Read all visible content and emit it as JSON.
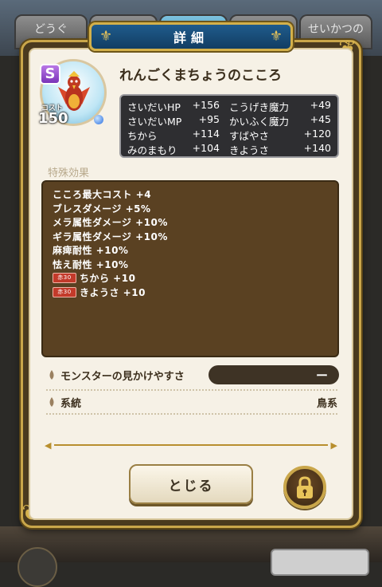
{
  "dialog": {
    "title": "詳細"
  },
  "background_tabs": [
    "どうぐ",
    "",
    "",
    "",
    "せいかつの"
  ],
  "heart": {
    "rank": "S",
    "cost_label": "コスト",
    "cost": "150",
    "name": "れんごくまちょうのこころ"
  },
  "stats": [
    {
      "k1": "さいだいHP",
      "v1": "+156",
      "k2": "こうげき魔力",
      "v2": "+49"
    },
    {
      "k1": "さいだいMP",
      "v1": "+95",
      "k2": "かいふく魔力",
      "v2": "+45"
    },
    {
      "k1": "ちから",
      "v1": "+114",
      "k2": "すばやさ",
      "v2": "+120"
    },
    {
      "k1": "みのまもり",
      "v1": "+104",
      "k2": "きようさ",
      "v2": "+140"
    }
  ],
  "special_effects": {
    "label": "特殊効果",
    "items": [
      {
        "text": "こころ最大コスト +4",
        "tag": ""
      },
      {
        "text": "ブレスダメージ +5%",
        "tag": ""
      },
      {
        "text": "メラ属性ダメージ +10%",
        "tag": ""
      },
      {
        "text": "ギラ属性ダメージ +10%",
        "tag": ""
      },
      {
        "text": "麻痺耐性 +10%",
        "tag": ""
      },
      {
        "text": "怯え耐性 +10%",
        "tag": ""
      },
      {
        "text": "ちから +10",
        "tag": "赤30"
      },
      {
        "text": "きようさ +10",
        "tag": "赤30"
      }
    ]
  },
  "info": {
    "appearance_label": "モンスターの見かけやすさ",
    "appearance_value": "ー",
    "lineage_label": "系統",
    "lineage_value": "鳥系"
  },
  "buttons": {
    "close": "とじる"
  },
  "colors": {
    "accent_gold": "#c9a64a",
    "title_blue": "#1f5b8c",
    "effects_bg": "#5a4122",
    "stats_bg": "#2e2e31"
  }
}
